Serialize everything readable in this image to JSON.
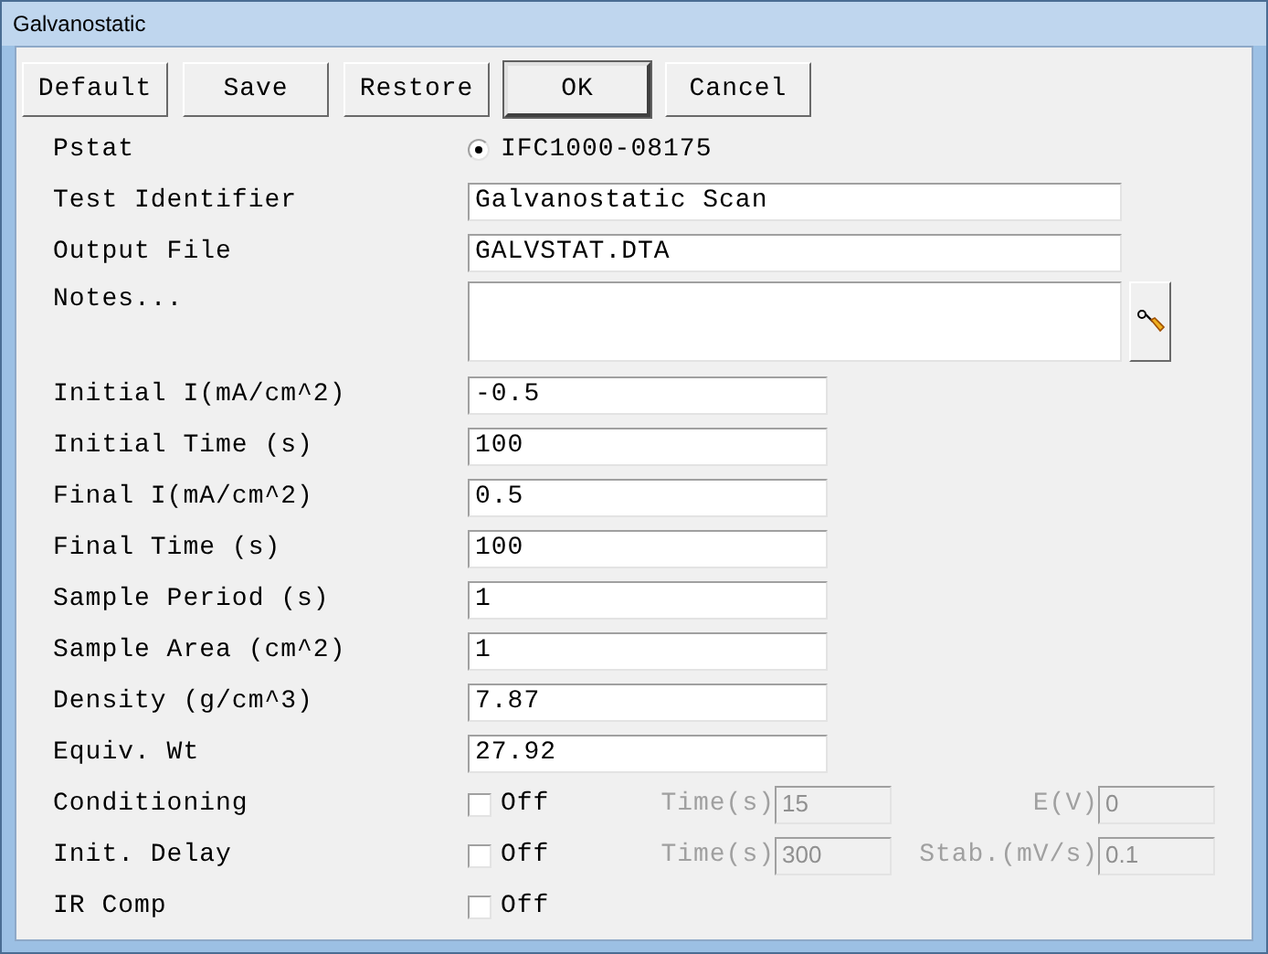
{
  "window": {
    "title": "Galvanostatic"
  },
  "buttons": [
    {
      "label": "Default",
      "is_default": false
    },
    {
      "label": "Save",
      "is_default": false
    },
    {
      "label": "Restore",
      "is_default": false
    },
    {
      "label": "OK",
      "is_default": true
    },
    {
      "label": "Cancel",
      "is_default": false
    }
  ],
  "rows": [
    {
      "kind": "radio",
      "label": "Pstat",
      "value": "IFC1000-08175",
      "selected": true
    },
    {
      "kind": "text",
      "label": "Test Identifier",
      "value": "Galvanostatic Scan"
    },
    {
      "kind": "text",
      "label": "Output File",
      "value": "GALVSTAT.DTA"
    },
    {
      "kind": "notes",
      "label": "Notes..."
    },
    {
      "kind": "number",
      "label": "Initial I(mA/cm^2)",
      "value": "-0.5"
    },
    {
      "kind": "number",
      "label": "Initial Time (s)",
      "value": "100"
    },
    {
      "kind": "number",
      "label": "Final I(mA/cm^2)",
      "value": "0.5"
    },
    {
      "kind": "number",
      "label": "Final Time (s)",
      "value": "100"
    },
    {
      "kind": "number",
      "label": "Sample Period (s)",
      "value": "1"
    },
    {
      "kind": "number",
      "label": "Sample Area (cm^2)",
      "value": "1"
    },
    {
      "kind": "number",
      "label": "Density (g/cm^3)",
      "value": "7.87"
    },
    {
      "kind": "number",
      "label": "Equiv. Wt",
      "value": "27.92"
    },
    {
      "kind": "option",
      "label": "Conditioning",
      "option": "Off",
      "checked": false,
      "extras": [
        {
          "label": "Time(s)",
          "value": "15",
          "disabled": true
        },
        {
          "label": "E(V)",
          "value": "0",
          "disabled": true
        }
      ]
    },
    {
      "kind": "option",
      "label": "Init. Delay",
      "option": "Off",
      "checked": false,
      "extras": [
        {
          "label": "Time(s)",
          "value": "300",
          "disabled": true
        },
        {
          "label": "Stab.(mV/s)",
          "value": "0.1",
          "disabled": true
        }
      ]
    },
    {
      "kind": "option",
      "label": "IR Comp",
      "option": "Off",
      "checked": false
    }
  ]
}
